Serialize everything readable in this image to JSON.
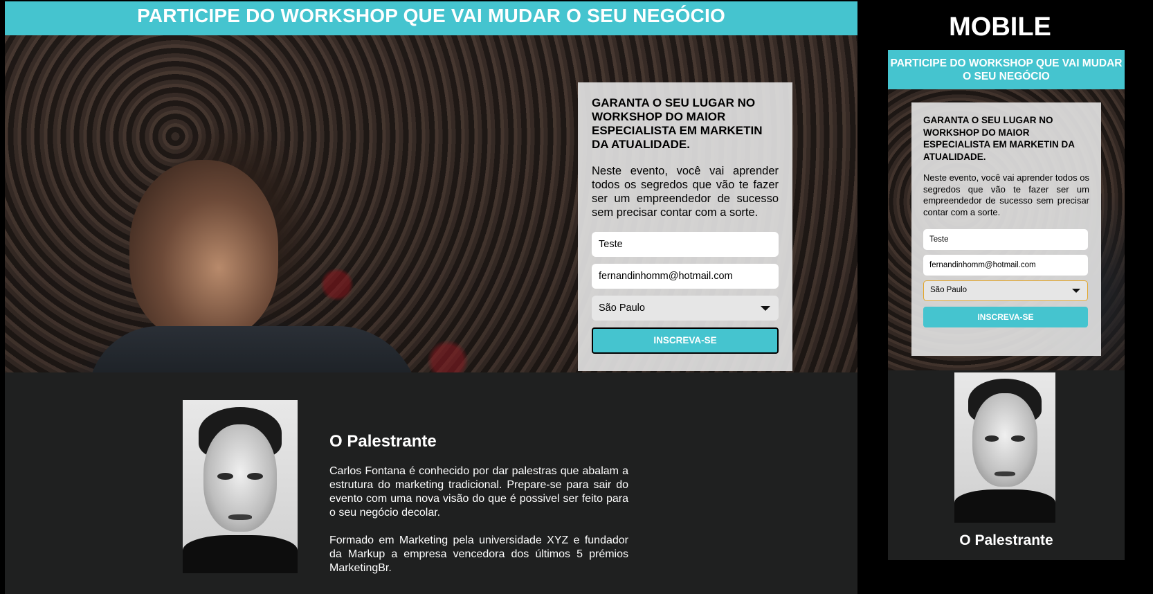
{
  "desktop": {
    "header_title": "PARTICIPE DO WORKSHOP QUE VAI MUDAR O SEU NEGÓCIO",
    "form": {
      "heading": "GARANTA O SEU LUGAR NO WORKSHOP DO MAIOR ESPECIALISTA EM MARKETIN DA ATUALIDADE.",
      "description": "Neste evento, você vai aprender todos os segredos que vão te fazer ser um empreendedor de sucesso sem precisar contar com a sorte.",
      "name_value": "Teste",
      "email_value": "fernandinhomm@hotmail.com",
      "city_selected": "São Paulo",
      "submit_label": "INSCREVA-SE"
    },
    "about": {
      "title": "O Palestrante",
      "paragraph1": "Carlos Fontana é conhecido por dar palestras que abalam a estrutura do marketing tradicional. Prepare-se para sair do evento com uma nova visão do que é possivel ser feito para o seu negócio decolar.",
      "paragraph2": "Formado em Marketing pela universidade XYZ e fundador da Markup a empresa vencedora dos últimos 5 prémios MarketingBr."
    }
  },
  "mobile": {
    "label": "MOBILE",
    "header_title": "PARTICIPE DO WORKSHOP QUE VAI MUDAR O SEU NEGÓCIO",
    "form": {
      "heading": "GARANTA O SEU LUGAR NO WORKSHOP DO MAIOR ESPECIALISTA EM MARKETIN DA ATUALIDADE.",
      "description": "Neste evento, você vai aprender todos os segredos que vão te fazer ser um empreendedor de sucesso sem precisar contar com a sorte.",
      "name_value": "Teste",
      "email_value": "fernandinhomm@hotmail.com",
      "city_selected": "São Paulo",
      "submit_label": "INSCREVA-SE"
    },
    "about_title": "O Palestrante"
  },
  "colors": {
    "accent": "#45c4cf",
    "section_bg": "#1f2020",
    "form_bg": "#e1e1e1",
    "focus_border": "#e3a62b"
  },
  "icons": {
    "select_caret": "caret-down-icon"
  }
}
